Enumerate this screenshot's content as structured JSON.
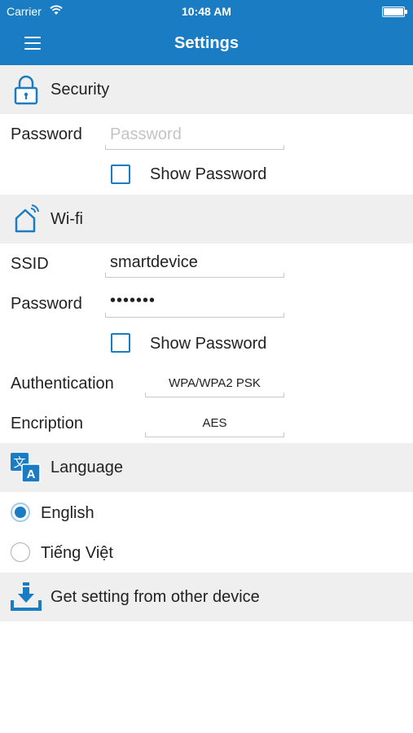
{
  "status": {
    "carrier": "Carrier",
    "time": "10:48 AM",
    "battery_level": 1.0
  },
  "nav": {
    "title": "Settings",
    "menu_icon": "hamburger-menu-icon"
  },
  "security": {
    "header": "Security",
    "icon": "lock-icon",
    "password_label": "Password",
    "password_placeholder": "Password",
    "password_value": "",
    "show_password_label": "Show Password",
    "show_password_checked": false
  },
  "wifi": {
    "header": "Wi-fi",
    "icon": "smart-home-wifi-icon",
    "ssid_label": "SSID",
    "ssid_value": "smartdevice",
    "password_label": "Password",
    "password_masked": "•••••••",
    "show_password_label": "Show Password",
    "show_password_checked": false,
    "authentication_label": "Authentication",
    "authentication_value": "WPA/WPA2 PSK",
    "encryption_label": "Encription",
    "encryption_value": "AES"
  },
  "language": {
    "header": "Language",
    "icon": "translate-icon",
    "options": [
      {
        "label": "English",
        "selected": true
      },
      {
        "label": "Tiếng Việt",
        "selected": false
      }
    ]
  },
  "get_setting": {
    "label": "Get setting from other device",
    "icon": "download-icon"
  },
  "colors": {
    "accent": "#1a7dc4",
    "section_bg": "#efefef",
    "text": "#222222"
  }
}
